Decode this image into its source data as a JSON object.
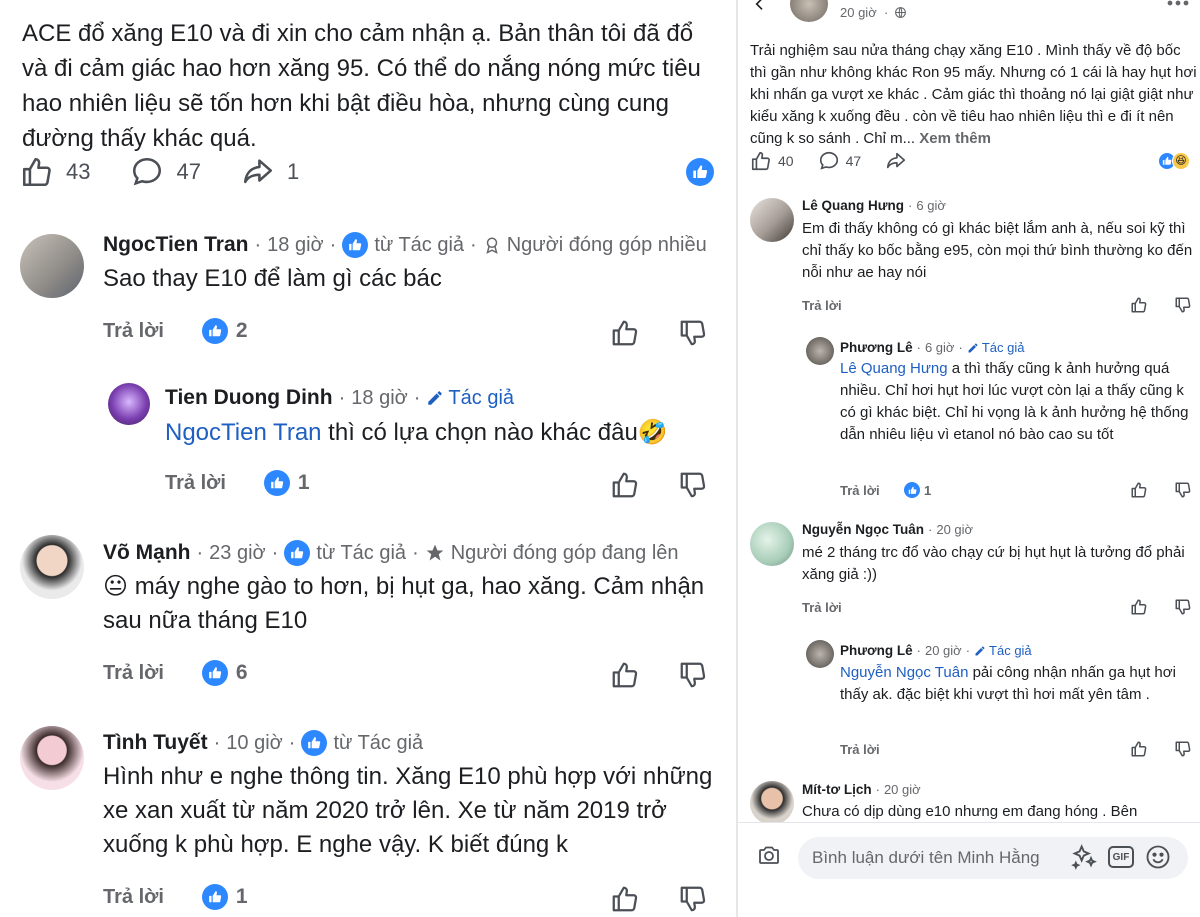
{
  "left": {
    "post_text": "ACE đổ xăng E10 và đi xin cho cảm nhận ạ. Bản thân tôi đã đổ và đi cảm giác hao hơn xăng 95. Có thể do nắng nóng mức tiêu hao nhiên liệu sẽ tốn hơn khi bật điều hòa, nhưng cùng cung đường thấy khác quá.",
    "likes": "43",
    "comments": "47",
    "shares": "1",
    "reply_label": "Trả lời",
    "from_author": "từ Tác giả",
    "author_badge": "Tác giả",
    "comments_list": [
      {
        "name": "NgocTien Tran",
        "time": "18 giờ",
        "badge": "Người đóng góp nhiều",
        "text": "Sao thay E10 để làm gì các bác",
        "likes": "2"
      },
      {
        "name": "Tien Duong Dinh",
        "time": "18 giờ",
        "mention": "NgocTien Tran",
        "text": " thì có lựa chọn nào khác đâu🤣",
        "likes": "1"
      },
      {
        "name": "Võ Mạnh",
        "time": "23 giờ",
        "badge": "Người đóng góp đang lên",
        "text": "😐 máy nghe gào to hơn, bị hụt ga, hao xăng. Cảm nhận sau nữa tháng E10",
        "likes": "6"
      },
      {
        "name": "Tình Tuyết",
        "time": "10 giờ",
        "text": "Hình như e nghe thông tin. Xăng E10 phù hợp với những xe xan xuất từ năm 2020 trở lên. Xe từ năm 2019 trở xuống k phù hợp. E nghe vậy. K biết đúng k",
        "likes": "1"
      }
    ]
  },
  "right": {
    "header_time": "20 giờ",
    "post_text": "Trải nghiệm sau nửa tháng chạy xăng E10 . Mình thấy về độ bốc thì gần như không khác Ron 95 mấy. Nhưng có 1 cái là hay hụt hơi khi nhấn ga vượt xe khác . Cảm giác thì thoảng nó lại giật giật như kiểu xăng k xuống đều . còn về tiêu hao nhiên liệu thì e đi ít nên cũng k so sánh . Chỉ m...",
    "see_more": "Xem thêm",
    "likes": "40",
    "comments": "47",
    "reply_label": "Trả lời",
    "author_badge": "Tác giả",
    "comments_list": [
      {
        "name": "Lê Quang Hưng",
        "time": "6 giờ",
        "text": "Em đi thấy không có gì khác biệt lắm anh à, nếu soi kỹ thì chỉ thấy ko bốc bằng e95, còn mọi thứ bình thường ko đến nỗi như ae hay nói"
      },
      {
        "name": "Phương Lê",
        "time": "6 giờ",
        "mention": "Lê Quang Hưng",
        "text": " a thì thấy cũng k ảnh hưởng quá nhiều. Chỉ hơi hụt hơi lúc vượt còn lại a thấy cũng k có gì khác biệt. Chỉ hi vọng là k ảnh hưởng hệ thống dẫn nhiêu liệu vì etanol nó bào cao su tốt",
        "likes": "1"
      },
      {
        "name": "Nguyễn Ngọc Tuân",
        "time": "20 giờ",
        "text": "mé 2 tháng trc đổ vào chạy cứ bị hụt hụt là tưởng đổ phải xăng giả :))"
      },
      {
        "name": "Phương Lê",
        "time": "20 giờ",
        "mention": "Nguyễn Ngọc Tuân",
        "text": " pải công nhận nhấn ga hụt hơi thấy ak. đặc biệt khi vượt thì hơi mất yên tâm ."
      },
      {
        "name": "Mít-tơ Lịch",
        "time": "20 giờ",
        "text": "Chưa có dịp dùng e10 nhưng em đang hóng . Bên"
      }
    ],
    "input_placeholder": "Bình luận dưới tên Minh Hằng"
  },
  "colors": {
    "accent": "#2d88ff",
    "mention": "#1e5fc2",
    "meta": "#65676b"
  }
}
